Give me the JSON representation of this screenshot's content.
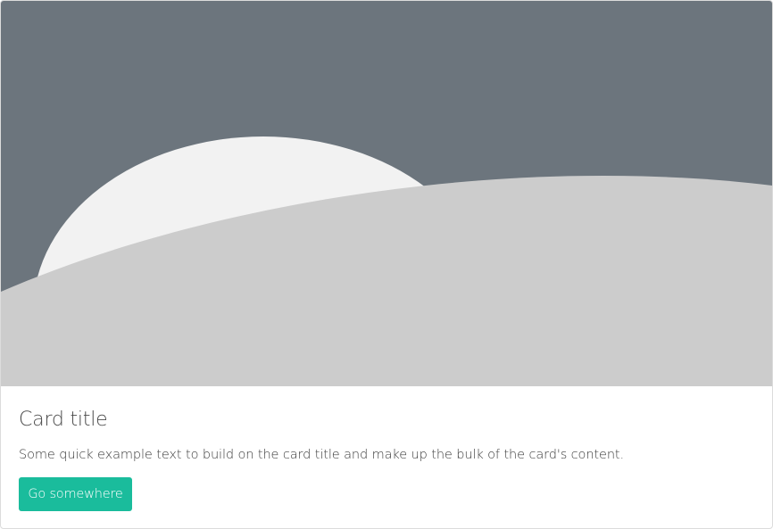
{
  "card": {
    "image": {
      "background_color": "#6c757d",
      "sun_color": "#f2f2f2",
      "hill_color": "#cccccc"
    },
    "title": "Card title",
    "text": "Some quick example text to build on the card title and make up the bulk of the card's content.",
    "button_label": "Go somewhere",
    "button_color": "#1abc9c"
  }
}
